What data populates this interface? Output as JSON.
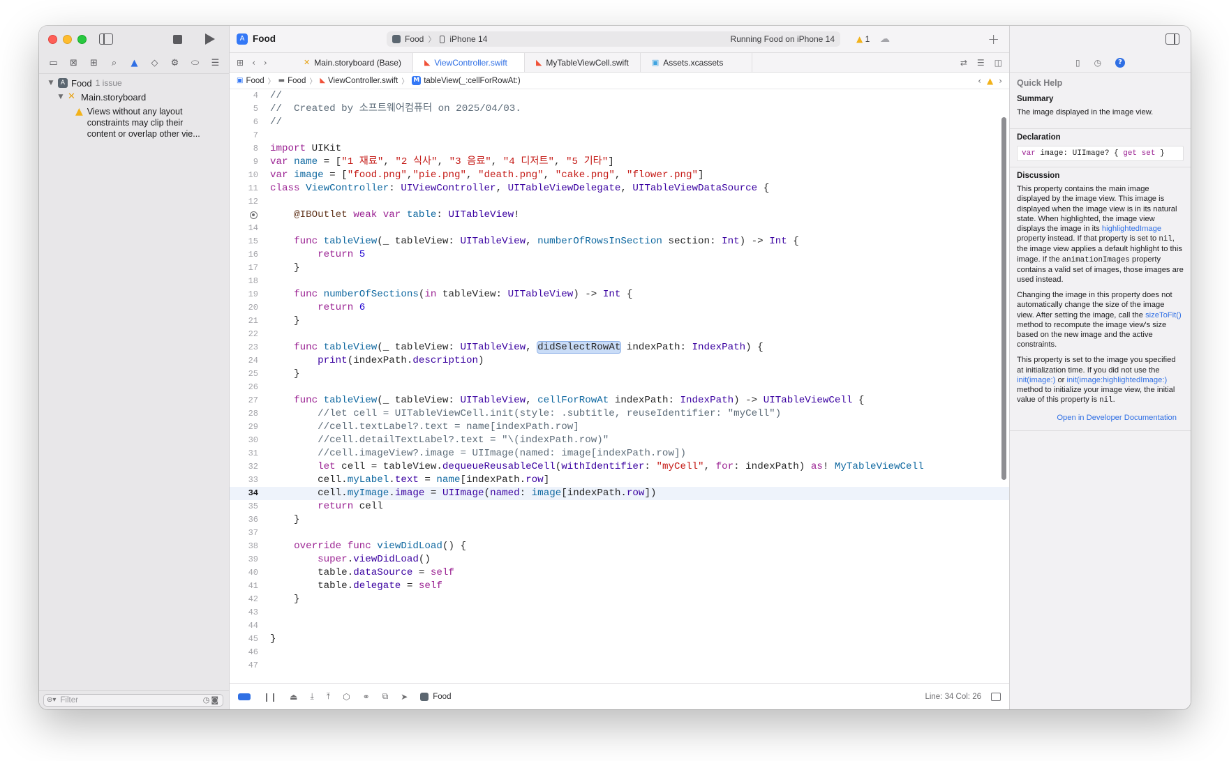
{
  "window": {
    "project_title": "Food",
    "scheme": {
      "target": "Food",
      "device": "iPhone 14",
      "status": "Running Food on iPhone 14"
    },
    "warning_count": "1"
  },
  "sidebar": {
    "project": {
      "name": "Food",
      "issue_label": "1 issue"
    },
    "file": "Main.storyboard",
    "warning": "Views without any layout constraints may clip their content or overlap other vie...",
    "filter_placeholder": "Filter"
  },
  "tabs": [
    {
      "label": "Main.storyboard (Base)"
    },
    {
      "label": "ViewController.swift"
    },
    {
      "label": "MyTableViewCell.swift"
    },
    {
      "label": "Assets.xcassets"
    }
  ],
  "jumpbar": [
    "Food",
    "Food",
    "ViewController.swift",
    "tableView(_:cellForRowAt:)"
  ],
  "code": {
    "current_line": 34,
    "lines": [
      {
        "n": "4",
        "t": [
          [
            "c",
            "//"
          ]
        ]
      },
      {
        "n": "5",
        "t": [
          [
            "c",
            "//  Created by 소프트웨어컴퓨터 on 2025/04/03."
          ]
        ]
      },
      {
        "n": "6",
        "t": [
          [
            "c",
            "//"
          ]
        ]
      },
      {
        "n": "7",
        "t": []
      },
      {
        "n": "8",
        "t": [
          [
            "k",
            "import"
          ],
          [
            "",
            " UIKit"
          ]
        ]
      },
      {
        "n": "9",
        "t": [
          [
            "k",
            "var"
          ],
          [
            "",
            " "
          ],
          [
            "f",
            "name"
          ],
          [
            "",
            " = ["
          ],
          [
            "s",
            "\"1 재료\""
          ],
          [
            "",
            ", "
          ],
          [
            "s",
            "\"2 식사\""
          ],
          [
            "",
            ", "
          ],
          [
            "s",
            "\"3 음료\""
          ],
          [
            "",
            ", "
          ],
          [
            "s",
            "\"4 디저트\""
          ],
          [
            "",
            ", "
          ],
          [
            "s",
            "\"5 기타\""
          ],
          [
            "",
            "]"
          ]
        ]
      },
      {
        "n": "10",
        "t": [
          [
            "k",
            "var"
          ],
          [
            "",
            " "
          ],
          [
            "f",
            "image"
          ],
          [
            "",
            " = ["
          ],
          [
            "s",
            "\"food.png\""
          ],
          [
            "",
            ","
          ],
          [
            "s",
            "\"pie.png\""
          ],
          [
            "",
            ", "
          ],
          [
            "s",
            "\"death.png\""
          ],
          [
            "",
            ", "
          ],
          [
            "s",
            "\"cake.png\""
          ],
          [
            "",
            ", "
          ],
          [
            "s",
            "\"flower.png\""
          ],
          [
            "",
            "]"
          ]
        ]
      },
      {
        "n": "11",
        "t": [
          [
            "k",
            "class"
          ],
          [
            "",
            " "
          ],
          [
            "f",
            "ViewController"
          ],
          [
            "",
            ": "
          ],
          [
            "t",
            "UIViewController"
          ],
          [
            "",
            ", "
          ],
          [
            "t",
            "UITableViewDelegate"
          ],
          [
            "",
            ", "
          ],
          [
            "t",
            "UITableViewDataSource"
          ],
          [
            "",
            " {"
          ]
        ]
      },
      {
        "n": "12",
        "t": []
      },
      {
        "n": "",
        "outlet": true,
        "t": [
          [
            "",
            "    "
          ],
          [
            "a",
            "@IBOutlet"
          ],
          [
            "",
            " "
          ],
          [
            "k",
            "weak"
          ],
          [
            "",
            " "
          ],
          [
            "k",
            "var"
          ],
          [
            "",
            " "
          ],
          [
            "f",
            "table"
          ],
          [
            "",
            ": "
          ],
          [
            "t",
            "UITableView"
          ],
          [
            "",
            "!"
          ]
        ]
      },
      {
        "n": "14",
        "t": []
      },
      {
        "n": "15",
        "t": [
          [
            "",
            "    "
          ],
          [
            "k",
            "func"
          ],
          [
            "",
            " "
          ],
          [
            "f",
            "tableView"
          ],
          [
            "",
            "(_ tableView: "
          ],
          [
            "t",
            "UITableView"
          ],
          [
            "",
            ", "
          ],
          [
            "f",
            "numberOfRowsInSection"
          ],
          [
            "",
            " section: "
          ],
          [
            "t",
            "Int"
          ],
          [
            "",
            ") -> "
          ],
          [
            "t",
            "Int"
          ],
          [
            "",
            " {"
          ]
        ]
      },
      {
        "n": "16",
        "t": [
          [
            "",
            "        "
          ],
          [
            "k",
            "return"
          ],
          [
            "",
            " "
          ],
          [
            "m",
            "5"
          ]
        ]
      },
      {
        "n": "17",
        "t": [
          [
            "",
            "    }"
          ]
        ]
      },
      {
        "n": "18",
        "t": []
      },
      {
        "n": "19",
        "t": [
          [
            "",
            "    "
          ],
          [
            "k",
            "func"
          ],
          [
            "",
            " "
          ],
          [
            "f",
            "numberOfSections"
          ],
          [
            "",
            "("
          ],
          [
            "k",
            "in"
          ],
          [
            "",
            " tableView: "
          ],
          [
            "t",
            "UITableView"
          ],
          [
            "",
            ") -> "
          ],
          [
            "t",
            "Int"
          ],
          [
            "",
            " {"
          ]
        ]
      },
      {
        "n": "20",
        "t": [
          [
            "",
            "        "
          ],
          [
            "k",
            "return"
          ],
          [
            "",
            " "
          ],
          [
            "m",
            "6"
          ]
        ]
      },
      {
        "n": "21",
        "t": [
          [
            "",
            "    }"
          ]
        ]
      },
      {
        "n": "22",
        "t": []
      },
      {
        "n": "23",
        "t": [
          [
            "",
            "    "
          ],
          [
            "k",
            "func"
          ],
          [
            "",
            " "
          ],
          [
            "f",
            "tableView"
          ],
          [
            "",
            "(_ tableView: "
          ],
          [
            "t",
            "UITableView"
          ],
          [
            "",
            ", "
          ],
          [
            "hl",
            "didSelectRowAt"
          ],
          [
            "",
            " indexPath: "
          ],
          [
            "t",
            "IndexPath"
          ],
          [
            "",
            ") {"
          ]
        ]
      },
      {
        "n": "24",
        "t": [
          [
            "",
            "        "
          ],
          [
            "t",
            "print"
          ],
          [
            "",
            "(indexPath."
          ],
          [
            "t",
            "description"
          ],
          [
            "",
            ")"
          ]
        ]
      },
      {
        "n": "25",
        "t": [
          [
            "",
            "    }"
          ]
        ]
      },
      {
        "n": "26",
        "t": []
      },
      {
        "n": "27",
        "t": [
          [
            "",
            "    "
          ],
          [
            "k",
            "func"
          ],
          [
            "",
            " "
          ],
          [
            "f",
            "tableView"
          ],
          [
            "",
            "(_ tableView: "
          ],
          [
            "t",
            "UITableView"
          ],
          [
            "",
            ", "
          ],
          [
            "f",
            "cellForRowAt"
          ],
          [
            "",
            " indexPath: "
          ],
          [
            "t",
            "IndexPath"
          ],
          [
            "",
            ") -> "
          ],
          [
            "t",
            "UITableViewCell"
          ],
          [
            "",
            " {"
          ]
        ]
      },
      {
        "n": "28",
        "t": [
          [
            "",
            "        "
          ],
          [
            "c",
            "//let cell = UITableViewCell.init(style: .subtitle, reuseIdentifier: \"myCell\")"
          ]
        ]
      },
      {
        "n": "29",
        "t": [
          [
            "",
            "        "
          ],
          [
            "c",
            "//cell.textLabel?.text = name[indexPath.row]"
          ]
        ]
      },
      {
        "n": "30",
        "t": [
          [
            "",
            "        "
          ],
          [
            "c",
            "//cell.detailTextLabel?.text = \"\\(indexPath.row)\""
          ]
        ]
      },
      {
        "n": "31",
        "t": [
          [
            "",
            "        "
          ],
          [
            "c",
            "//cell.imageView?.image = UIImage(named: image[indexPath.row])"
          ]
        ]
      },
      {
        "n": "32",
        "t": [
          [
            "",
            "        "
          ],
          [
            "k",
            "let"
          ],
          [
            "",
            " cell = tableView."
          ],
          [
            "t",
            "dequeueReusableCell"
          ],
          [
            "",
            "("
          ],
          [
            "t",
            "withIdentifier"
          ],
          [
            "",
            ": "
          ],
          [
            "s",
            "\"myCell\""
          ],
          [
            "",
            ", "
          ],
          [
            "k",
            "for"
          ],
          [
            "",
            ": indexPath) "
          ],
          [
            "k",
            "as"
          ],
          [
            "",
            "! "
          ],
          [
            "f",
            "MyTableViewCell"
          ]
        ]
      },
      {
        "n": "33",
        "t": [
          [
            "",
            "        cell."
          ],
          [
            "f",
            "myLabel"
          ],
          [
            "",
            "."
          ],
          [
            "t",
            "text"
          ],
          [
            "",
            " = "
          ],
          [
            "f",
            "name"
          ],
          [
            "",
            "[indexPath."
          ],
          [
            "t",
            "row"
          ],
          [
            "",
            "]"
          ]
        ]
      },
      {
        "n": "34",
        "t": [
          [
            "",
            "        cell."
          ],
          [
            "f",
            "myImage"
          ],
          [
            "",
            "."
          ],
          [
            "t",
            "image"
          ],
          [
            "",
            " = "
          ],
          [
            "t",
            "UIImage"
          ],
          [
            "",
            "("
          ],
          [
            "t",
            "named"
          ],
          [
            "",
            ": "
          ],
          [
            "f",
            "image"
          ],
          [
            "",
            "[indexPath."
          ],
          [
            "t",
            "row"
          ],
          [
            "",
            "])"
          ]
        ]
      },
      {
        "n": "35",
        "t": [
          [
            "",
            "        "
          ],
          [
            "k",
            "return"
          ],
          [
            "",
            " cell"
          ]
        ]
      },
      {
        "n": "36",
        "t": [
          [
            "",
            "    }"
          ]
        ]
      },
      {
        "n": "37",
        "t": []
      },
      {
        "n": "38",
        "t": [
          [
            "",
            "    "
          ],
          [
            "k",
            "override"
          ],
          [
            "",
            " "
          ],
          [
            "k",
            "func"
          ],
          [
            "",
            " "
          ],
          [
            "f",
            "viewDidLoad"
          ],
          [
            "",
            "() {"
          ]
        ]
      },
      {
        "n": "39",
        "t": [
          [
            "",
            "        "
          ],
          [
            "k",
            "super"
          ],
          [
            "",
            "."
          ],
          [
            "t",
            "viewDidLoad"
          ],
          [
            "",
            "()"
          ]
        ]
      },
      {
        "n": "40",
        "t": [
          [
            "",
            "        table."
          ],
          [
            "t",
            "dataSource"
          ],
          [
            "",
            " = "
          ],
          [
            "k",
            "self"
          ]
        ]
      },
      {
        "n": "41",
        "t": [
          [
            "",
            "        table."
          ],
          [
            "t",
            "delegate"
          ],
          [
            "",
            " = "
          ],
          [
            "k",
            "self"
          ]
        ]
      },
      {
        "n": "42",
        "t": [
          [
            "",
            "    }"
          ]
        ]
      },
      {
        "n": "43",
        "t": []
      },
      {
        "n": "44",
        "t": []
      },
      {
        "n": "45",
        "t": [
          [
            "",
            "}"
          ]
        ]
      },
      {
        "n": "46",
        "t": []
      },
      {
        "n": "47",
        "t": []
      }
    ]
  },
  "debugbar": {
    "target": "Food",
    "line_col": "Line: 34  Col: 26"
  },
  "quick_help": {
    "title": "Quick Help",
    "summary_heading": "Summary",
    "summary": "The image displayed in the image view.",
    "declaration_heading": "Declaration",
    "declaration": {
      "kw1": "var",
      "name": " image: UIImage? { ",
      "kw2": "get",
      "sp": " ",
      "kw3": "set",
      "end": " }"
    },
    "discussion_heading": "Discussion",
    "p1": {
      "a": "This property contains the main image displayed by the image view. This image is displayed when the image view is in its natural state. When highlighted, the image view displays the image in its ",
      "link": "highlightedImage",
      "b": " property instead. If that property is set to ",
      "code1": "nil",
      "c": ", the image view applies a default highlight to this image. If the ",
      "code2": "animationImages",
      "d": " property contains a valid set of images, those images are used instead."
    },
    "p2": {
      "a": "Changing the image in this property does not automatically change the size of the image view. After setting the image, call the ",
      "link": "sizeToFit()",
      "b": " method to recompute the image view's size based on the new image and the active constraints."
    },
    "p3": {
      "a": "This property is set to the image you specified at initialization time. If you did not use the ",
      "link1": "init(image:)",
      "b": " or ",
      "link2": "init(image:highlightedImage:)",
      "c": " method to initialize your image view, the initial value of this property is ",
      "code": "nil",
      "d": "."
    },
    "open_docs": "Open in Developer Documentation"
  },
  "icons": {
    "nav": [
      "folder-icon",
      "source-control-icon",
      "symbol-icon",
      "find-icon",
      "issue-icon",
      "test-icon",
      "debug-icon",
      "breakpoint-icon",
      "report-icon"
    ]
  },
  "colors": {
    "keyword": "#9b2393",
    "string": "#c41a16",
    "type": "#3900a0",
    "declaration": "#0f68a0",
    "number": "#1c00cf",
    "comment": "#5d6c79",
    "accent": "#2f6fe4"
  }
}
